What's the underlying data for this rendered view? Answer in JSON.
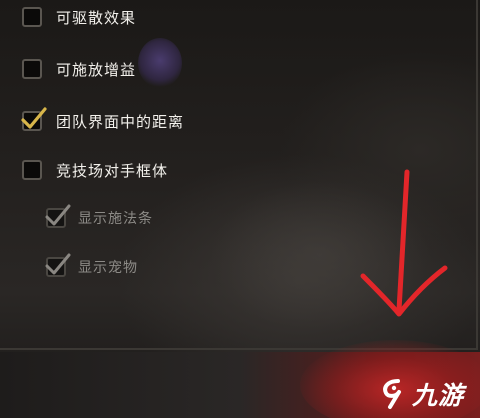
{
  "options": [
    {
      "label": "可驱散效果",
      "checked": false,
      "enabled": true
    },
    {
      "label": "可施放增益",
      "checked": false,
      "enabled": true
    },
    {
      "label": "团队界面中的距离",
      "checked": true,
      "enabled": true
    },
    {
      "label": "竞技场对手框体",
      "checked": false,
      "enabled": true
    },
    {
      "label": "显示施法条",
      "checked": true,
      "enabled": false
    },
    {
      "label": "显示宠物",
      "checked": true,
      "enabled": false
    }
  ],
  "annotation": {
    "icon": "red-arrow-down-icon",
    "color": "#e3262a"
  },
  "watermark": {
    "text": "九游",
    "icon": "jiuyou-logo-icon"
  },
  "colors": {
    "check_active": "#d8b64a",
    "check_disabled": "#8a8782",
    "text": "#f3f1ec",
    "text_disabled": "#8c8a86"
  }
}
